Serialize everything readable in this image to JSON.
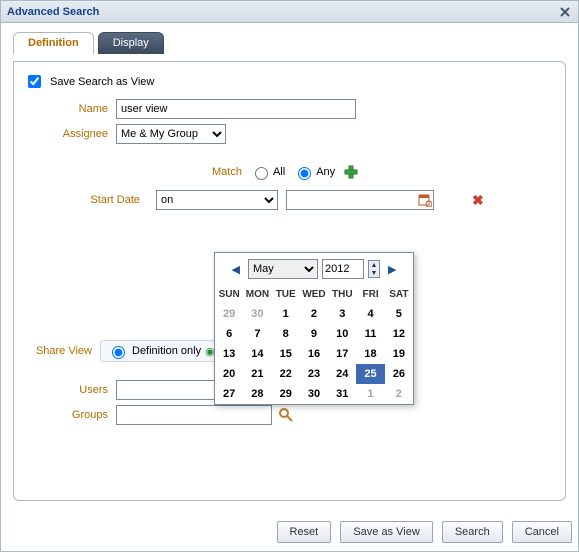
{
  "window": {
    "title": "Advanced Search"
  },
  "tabs": {
    "definition": "Definition",
    "display": "Display"
  },
  "checkbox": {
    "save_as_view": "Save Search as View"
  },
  "fields": {
    "name_label": "Name",
    "name_value": "user view",
    "assignee_label": "Assignee",
    "assignee_value": "Me & My Group",
    "match_label": "Match",
    "match_all": "All",
    "match_any": "Any",
    "startdate_label": "Start Date",
    "startdate_op": "on",
    "share_label": "Share View",
    "definition_only": "Definition only",
    "users_label": "Users",
    "groups_label": "Groups"
  },
  "calendar": {
    "month": "May",
    "year": "2012",
    "weekdays": [
      "SUN",
      "MON",
      "TUE",
      "WED",
      "THU",
      "FRI",
      "SAT"
    ],
    "rows": [
      [
        {
          "d": "29",
          "o": true
        },
        {
          "d": "30",
          "o": true
        },
        {
          "d": "1"
        },
        {
          "d": "2"
        },
        {
          "d": "3"
        },
        {
          "d": "4"
        },
        {
          "d": "5"
        }
      ],
      [
        {
          "d": "6"
        },
        {
          "d": "7"
        },
        {
          "d": "8"
        },
        {
          "d": "9"
        },
        {
          "d": "10"
        },
        {
          "d": "11"
        },
        {
          "d": "12"
        }
      ],
      [
        {
          "d": "13"
        },
        {
          "d": "14"
        },
        {
          "d": "15"
        },
        {
          "d": "16"
        },
        {
          "d": "17"
        },
        {
          "d": "18"
        },
        {
          "d": "19"
        }
      ],
      [
        {
          "d": "20"
        },
        {
          "d": "21"
        },
        {
          "d": "22"
        },
        {
          "d": "23"
        },
        {
          "d": "24"
        },
        {
          "d": "25",
          "sel": true
        },
        {
          "d": "26"
        }
      ],
      [
        {
          "d": "27"
        },
        {
          "d": "28"
        },
        {
          "d": "29"
        },
        {
          "d": "30"
        },
        {
          "d": "31"
        },
        {
          "d": "1",
          "o": true
        },
        {
          "d": "2",
          "o": true
        }
      ]
    ]
  },
  "footer": {
    "reset": "Reset",
    "save_as_view": "Save as View",
    "search": "Search",
    "cancel": "Cancel"
  }
}
